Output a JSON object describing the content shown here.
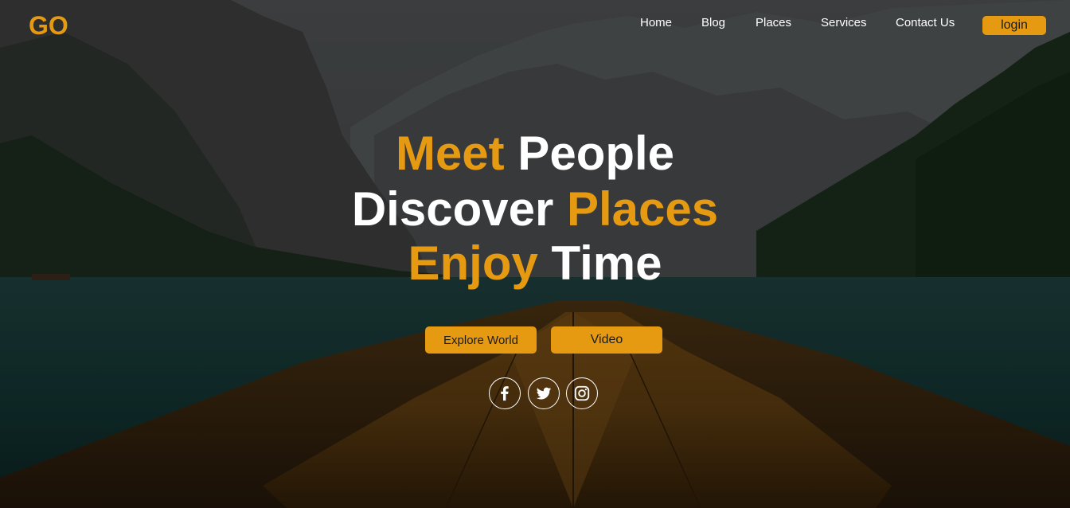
{
  "brand": {
    "logo_text": "GO"
  },
  "nav": {
    "items": [
      {
        "label": "Home"
      },
      {
        "label": "Blog"
      },
      {
        "label": "Places"
      },
      {
        "label": "Services"
      },
      {
        "label": "Contact Us"
      }
    ],
    "login_label": "login"
  },
  "hero": {
    "line1": {
      "accent": "Meet",
      "rest": " People"
    },
    "line2": {
      "plain": "Discover ",
      "accent": "Places"
    },
    "line3": {
      "accent": "Enjoy",
      "rest": " Time"
    },
    "buttons": {
      "explore": "Explore World",
      "video": "Video"
    },
    "background_icon": "lake-mountain-boat-photo"
  },
  "social": {
    "icons": [
      "facebook-icon",
      "twitter-icon",
      "instagram-icon"
    ]
  },
  "colors": {
    "accent": "#e69a12",
    "text": "#ffffff",
    "button_text": "#1b1b1b"
  }
}
